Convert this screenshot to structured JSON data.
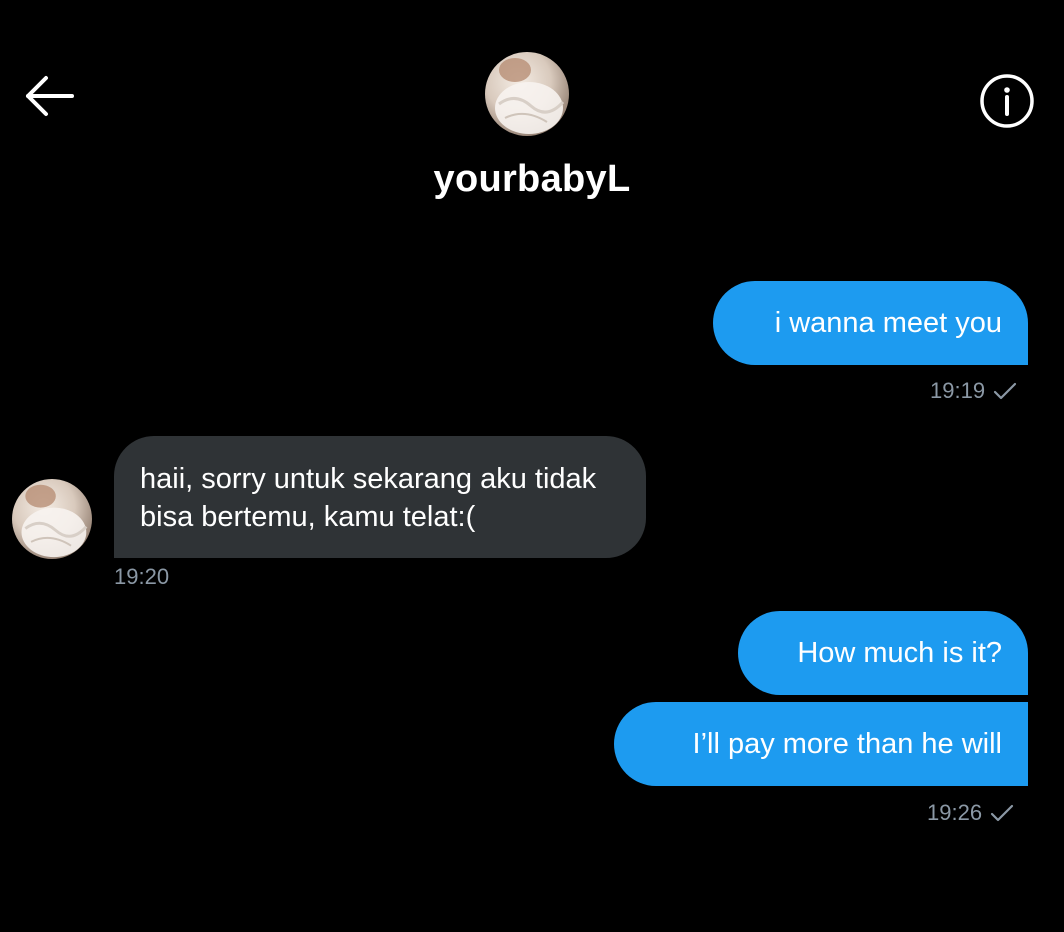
{
  "header": {
    "username": "yourbabyL",
    "back_icon": "arrow-left-icon",
    "info_icon": "info-circle-icon"
  },
  "messages": [
    {
      "direction": "outgoing",
      "text": "i wanna meet you"
    },
    {
      "direction": "outgoing",
      "meta_time": "19:19"
    },
    {
      "direction": "incoming",
      "text": "haii, sorry untuk sekarang aku tidak bisa bertemu, kamu telat:(",
      "meta_time": "19:20"
    },
    {
      "direction": "outgoing",
      "text": "How much is it?"
    },
    {
      "direction": "outgoing",
      "text": "I’ll pay more than he will",
      "meta_time": "19:26"
    }
  ],
  "colors": {
    "background": "#000000",
    "outgoing_bubble": "#1d9bf0",
    "incoming_bubble": "#2f3336",
    "meta_text": "#8b98a5"
  }
}
